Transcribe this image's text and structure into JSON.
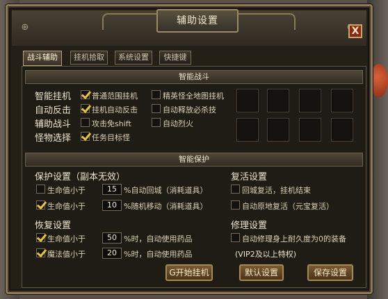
{
  "window": {
    "title": "辅助设置",
    "close_label": "X"
  },
  "tabs": [
    {
      "label": "战斗辅助",
      "active": true
    },
    {
      "label": "挂机拾取",
      "active": false
    },
    {
      "label": "系统设置",
      "active": false
    },
    {
      "label": "快捷键",
      "active": false
    }
  ],
  "combat": {
    "header": "智能战斗",
    "labels": [
      "智能挂机",
      "自动反击",
      "辅助战斗",
      "怪物选择"
    ],
    "options": [
      {
        "label": "普通范围挂机",
        "checked": true
      },
      {
        "label": "精英怪全地图挂机",
        "checked": false
      },
      {
        "label": "挂机自动反击",
        "checked": true
      },
      {
        "label": "自动释放必杀技",
        "checked": false
      },
      {
        "label": "攻击免shift",
        "checked": false
      },
      {
        "label": "自动烈火",
        "checked": false
      },
      {
        "label": "任务目标怪",
        "checked": true
      }
    ]
  },
  "protect": {
    "header": "智能保护",
    "protect_title": "保护设置（副本无效）",
    "protect_rows": [
      {
        "label": "生命值小于",
        "value": "15",
        "suffix": "%自动回城（消耗道具）",
        "checked": false
      },
      {
        "label": "生命值小于",
        "value": "10",
        "suffix": "%随机移动（消耗道具）",
        "checked": true
      }
    ],
    "recover_title": "恢复设置",
    "recover_rows": [
      {
        "label": "生命值小于",
        "value": "50",
        "suffix": "%时，自动使用药品",
        "checked": true
      },
      {
        "label": "魔法值小于",
        "value": "20",
        "suffix": "%时，自动使用药品",
        "checked": true
      }
    ],
    "revive_title": "复活设置",
    "revive_options": [
      {
        "label": "回城复活，挂机结束",
        "checked": false
      },
      {
        "label": "自动原地复活（元宝复活）",
        "checked": false
      }
    ],
    "repair_title": "修理设置",
    "repair_option": {
      "label": "自动修理身上耐久度为0的装备",
      "checked": false
    },
    "vip_note": "(VIP2及以上特权)"
  },
  "buttons": {
    "start": "G开始挂机",
    "default": "默认设置",
    "save": "保存设置"
  },
  "colors": {
    "check": "#e8c23a",
    "frame": "#8c7a58",
    "close": "#8a2a16"
  }
}
